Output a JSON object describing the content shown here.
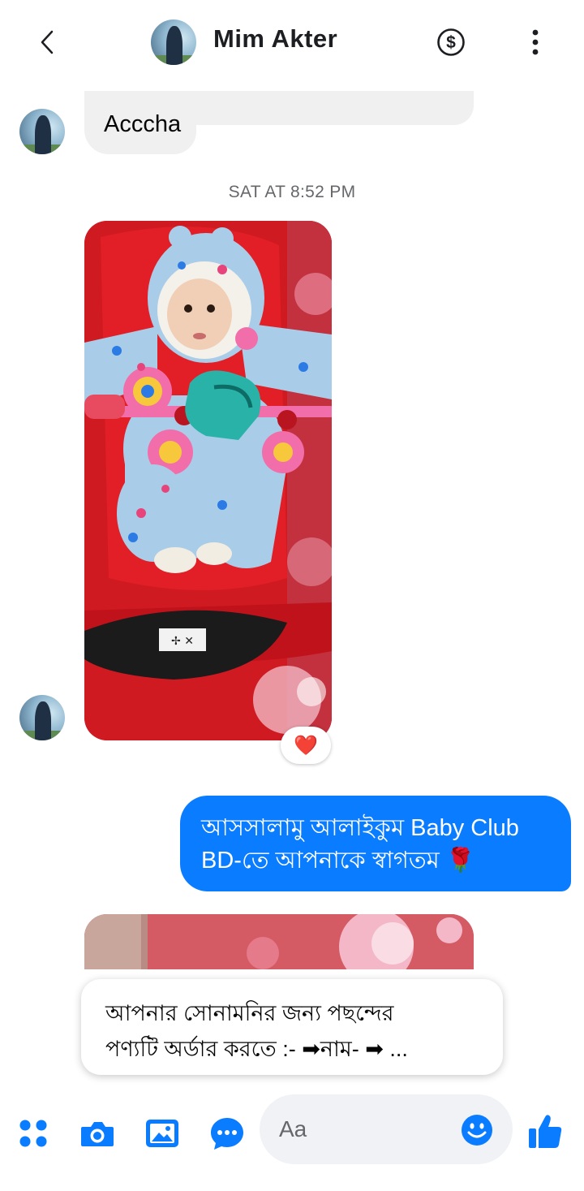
{
  "header": {
    "contact_name": "Mim Akter",
    "icons": {
      "back": "chevron-left-icon",
      "payment": "dollar-circle-icon",
      "more": "vertical-dots-icon"
    }
  },
  "messages": {
    "incoming_text": "Acccha",
    "timestamp": "SAT AT 8:52 PM",
    "reaction": "❤️",
    "outgoing_line1": "আসসালামু আলাইকুম Baby Club",
    "outgoing_line2": "BD-তে আপনাকে স্বাগতম 🌹"
  },
  "suggestion": {
    "line1": "আপনার সোনামনির জন্য পছন্দের",
    "line2": "পণ্যটি অর্ডার করতে :- ➡নাম- ➡ ..."
  },
  "composer": {
    "placeholder": "Aa",
    "accent_color": "#0a7cff",
    "icons": [
      "menu-grid-icon",
      "camera-icon",
      "gallery-icon",
      "chat-bubble-icon",
      "emoji-icon",
      "thumbs-up-icon"
    ]
  }
}
